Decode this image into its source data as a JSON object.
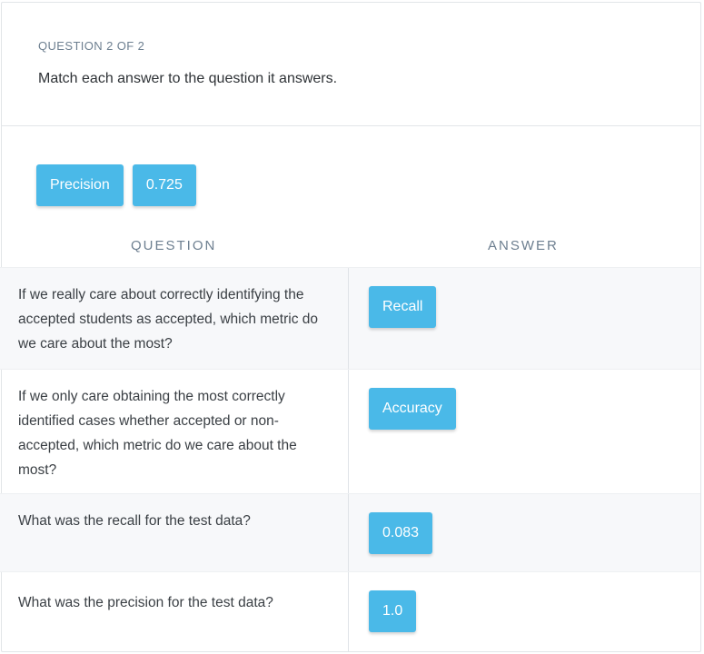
{
  "header": {
    "counter": "QUESTION 2 OF 2",
    "prompt": "Match each answer to the question it answers."
  },
  "pool": {
    "chips": [
      "Precision",
      "0.725"
    ]
  },
  "columns": {
    "question": "QUESTION",
    "answer": "ANSWER"
  },
  "rows": [
    {
      "question": "If we really care about correctly identifying the accepted students as accepted, which metric do we care about the most?",
      "answer": "Recall"
    },
    {
      "question": "If we only care obtaining the most correctly identified cases whether accepted or non-accepted, which metric do we care about the most?",
      "answer": "Accuracy"
    },
    {
      "question": "What was the recall for the test data?",
      "answer": "0.083"
    },
    {
      "question": "What was the precision for the test data?",
      "answer": "1.0"
    }
  ],
  "colors": {
    "chip": "#4ab9e8",
    "alt_row": "#f7f8fa",
    "muted_text": "#6d7f90"
  }
}
